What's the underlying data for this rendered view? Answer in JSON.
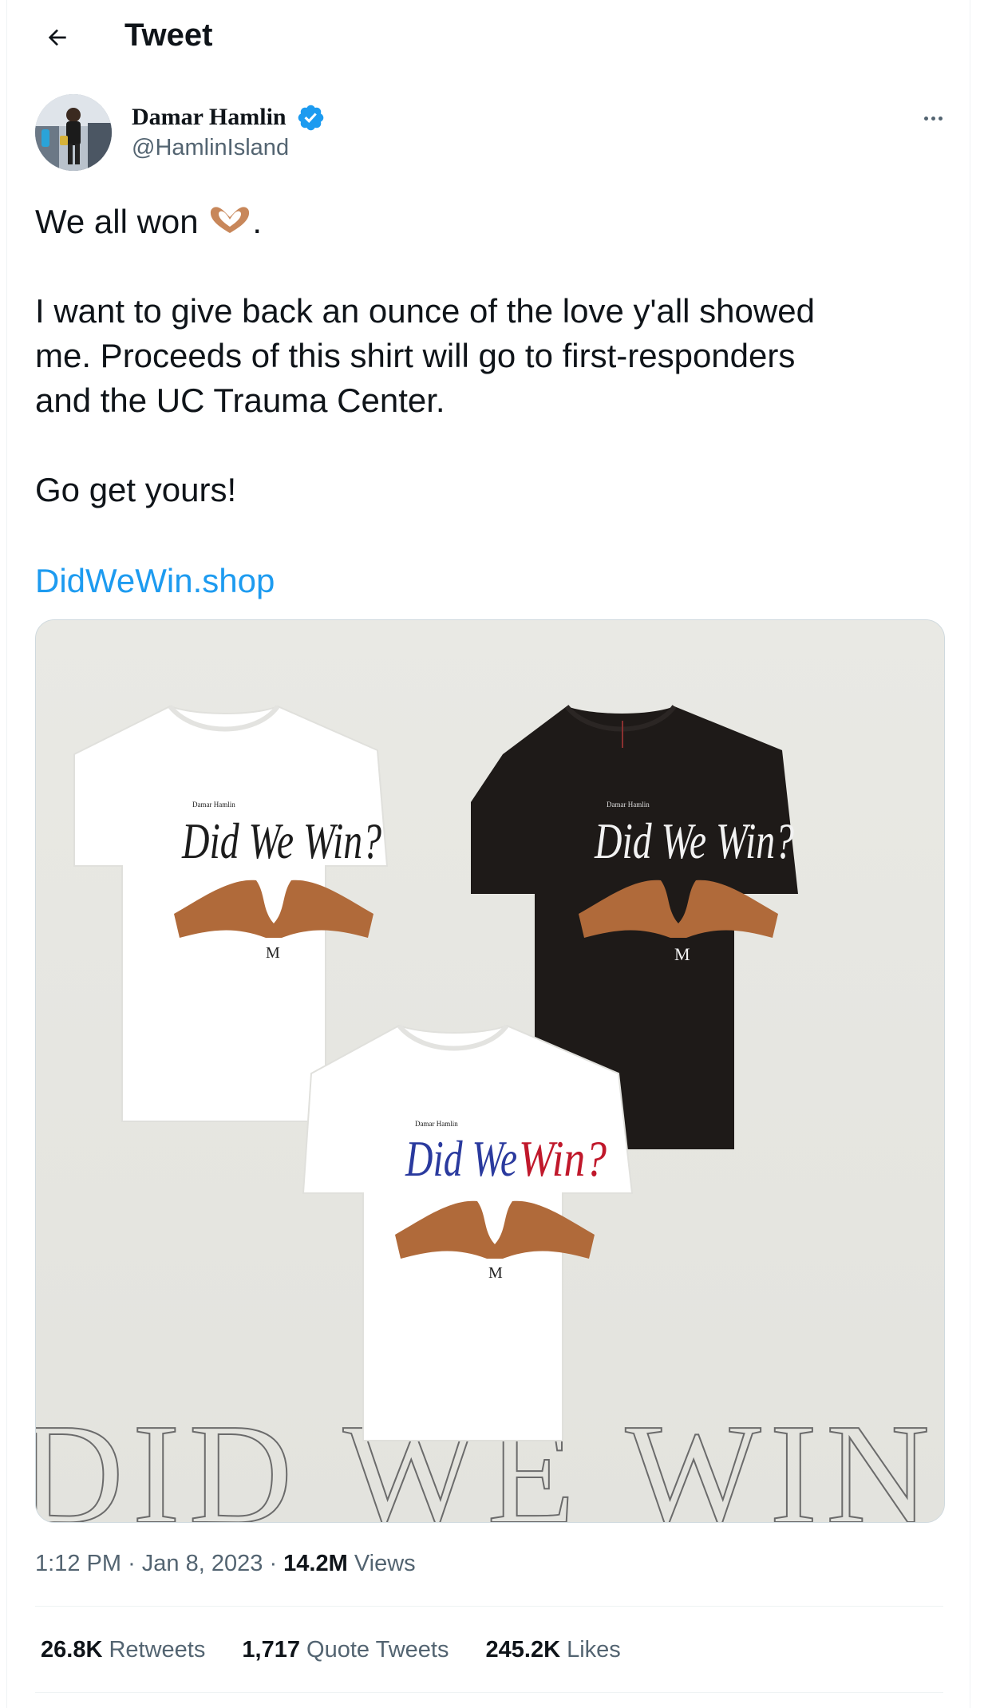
{
  "header": {
    "title": "Tweet",
    "back_icon": "arrow-left-icon"
  },
  "author": {
    "name": "Damar Hamlin",
    "handle": "@HamlinIsland",
    "verified_color": "#1d9bf0",
    "more_icon": "more-horizontal-icon"
  },
  "tweet": {
    "line1_text": "We all won ",
    "line1_suffix": ".",
    "emoji": "heart-hands-emoji",
    "para2": [
      "I want to give back an ounce of the love y'all showed",
      "me. Proceeds of this shirt will go to first-responders",
      "and the UC Trauma Center."
    ],
    "para3": "Go get yours!",
    "link": "DidWeWin.shop"
  },
  "media": {
    "shirts": [
      {
        "small_text": "Damar Hamlin",
        "headline": "Did We Win?",
        "mark": "M"
      },
      {
        "small_text": "Damar Hamlin",
        "headline": "Did We Win?",
        "mark": "M"
      },
      {
        "small_text": "Damar Hamlin",
        "headline_part1": "Did We",
        "headline_part2": "Win?",
        "mark": "M"
      }
    ],
    "background_text": "DID WE WIN",
    "colors": {
      "background": "#e7e7e2",
      "black_shirt": "#1e1a18",
      "blue": "#2a3a9e",
      "red": "#c0182b"
    }
  },
  "meta": {
    "time": "1:12 PM",
    "sep": "·",
    "date": "Jan 8, 2023",
    "views_count": "14.2M",
    "views_label": "Views"
  },
  "stats": {
    "retweets_count": "26.8K",
    "retweets_label": "Retweets",
    "quotes_count": "1,717",
    "quotes_label": "Quote Tweets",
    "likes_count": "245.2K",
    "likes_label": "Likes"
  },
  "accent": "#1d9bf0"
}
